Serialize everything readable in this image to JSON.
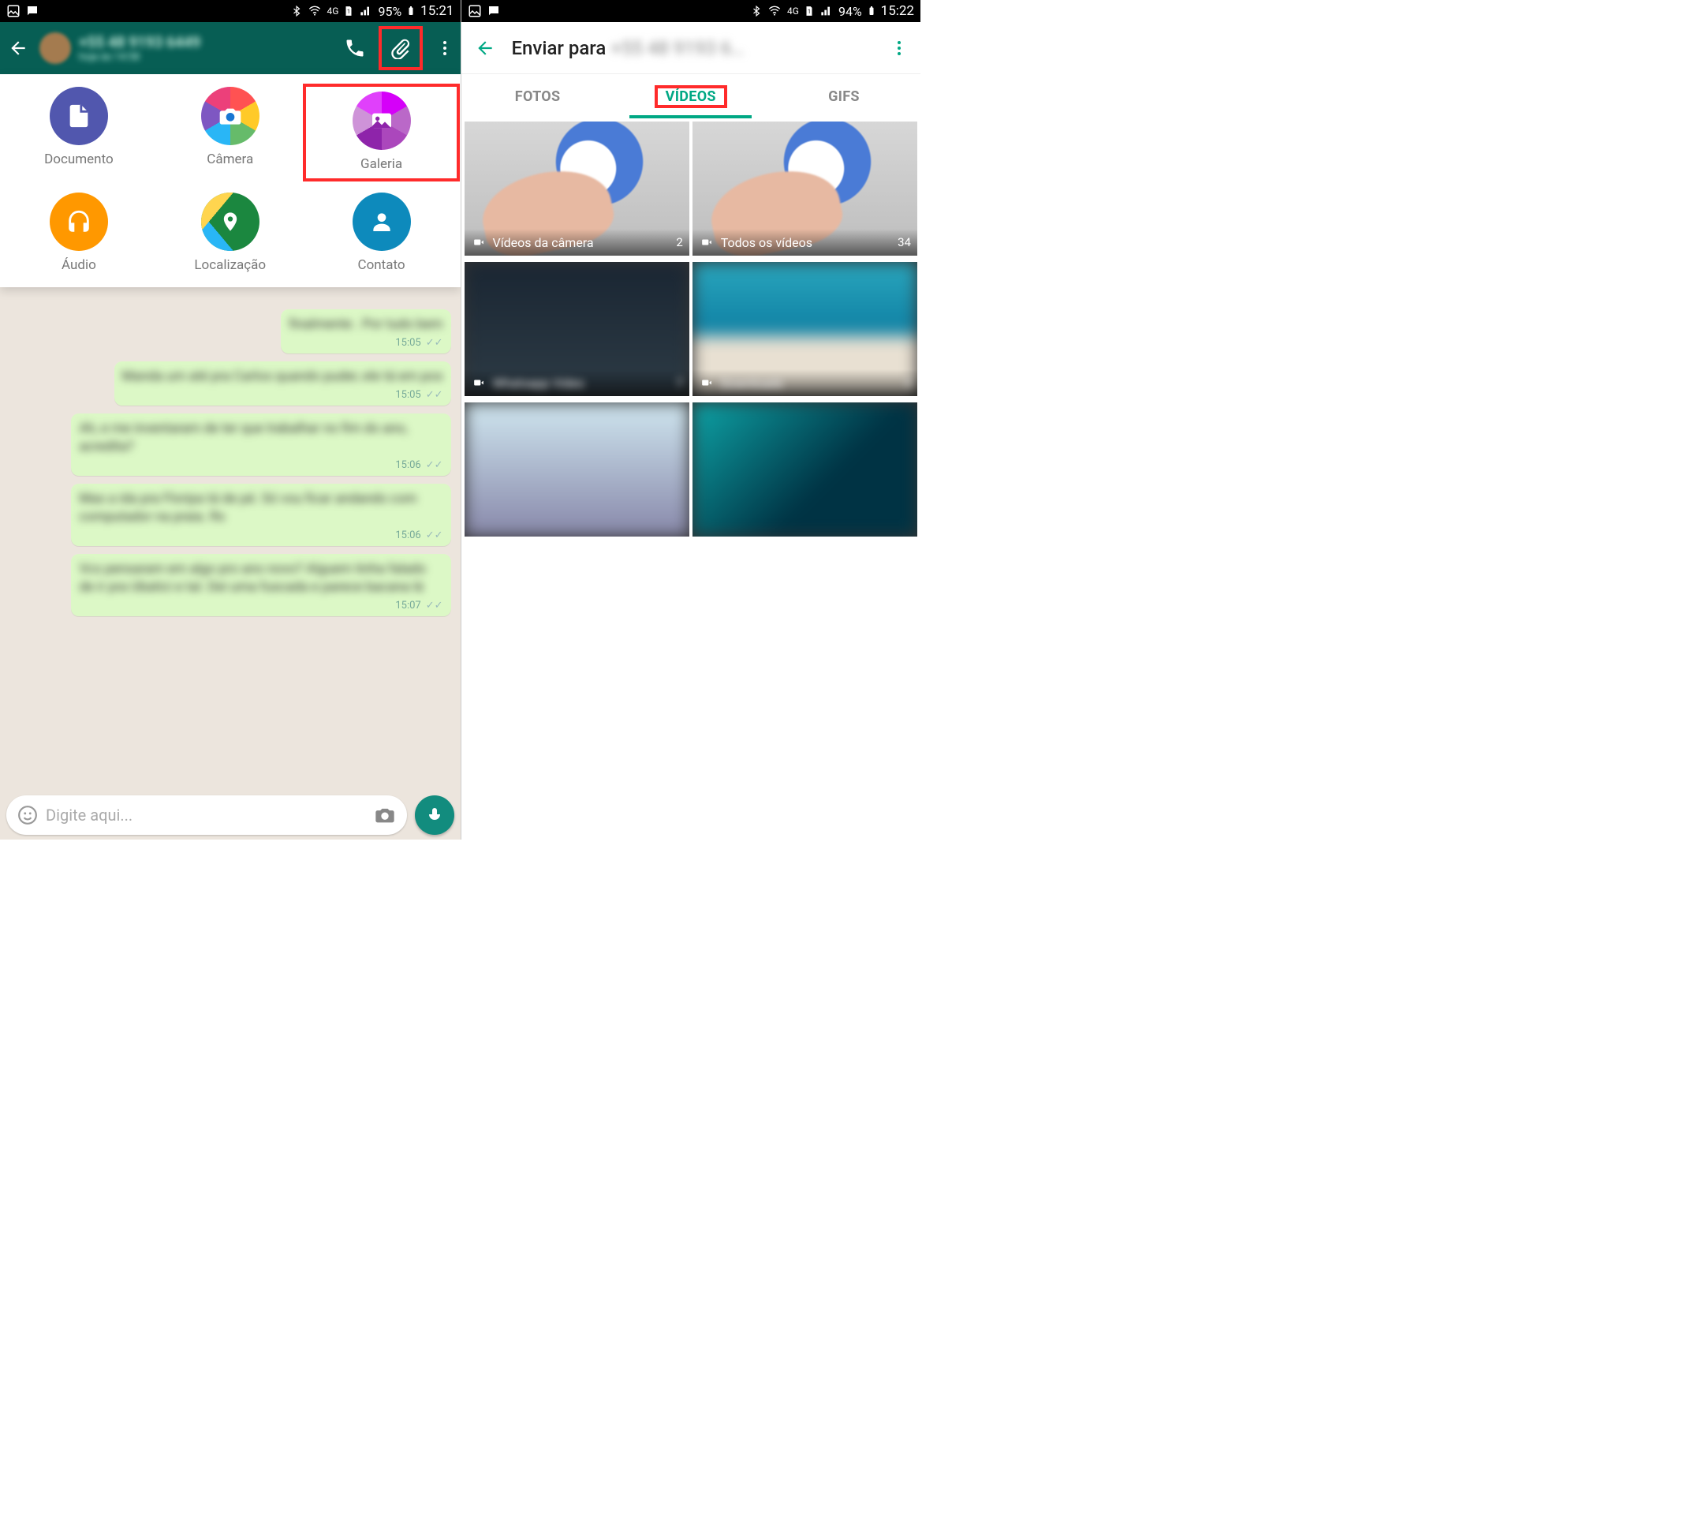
{
  "left": {
    "statusbar": {
      "battery": "95%",
      "time": "15:21",
      "network": "4G"
    },
    "header": {},
    "attach": [
      {
        "name": "document",
        "label": "Documento"
      },
      {
        "name": "camera",
        "label": "Câmera"
      },
      {
        "name": "gallery",
        "label": "Galeria"
      },
      {
        "name": "audio",
        "label": "Áudio"
      },
      {
        "name": "location",
        "label": "Localização"
      },
      {
        "name": "contact",
        "label": "Contato"
      }
    ],
    "messages": [
      {
        "time": "15:05"
      },
      {
        "time": "15:05"
      },
      {
        "time": "15:06"
      },
      {
        "time": "15:06"
      },
      {
        "time": "15:07"
      }
    ],
    "input": {
      "placeholder": "Digite aqui..."
    }
  },
  "right": {
    "statusbar": {
      "battery": "94%",
      "time": "15:22",
      "network": "4G"
    },
    "header": {
      "title": "Enviar para"
    },
    "tabs": [
      {
        "id": "fotos",
        "label": "FOTOS",
        "active": false
      },
      {
        "id": "videos",
        "label": "VÍDEOS",
        "active": true
      },
      {
        "id": "gifs",
        "label": "GIFS",
        "active": false
      }
    ],
    "albums": [
      {
        "name": "Vídeos da câmera",
        "count": "2"
      },
      {
        "name": "Todos os vídeos",
        "count": "34"
      }
    ]
  }
}
